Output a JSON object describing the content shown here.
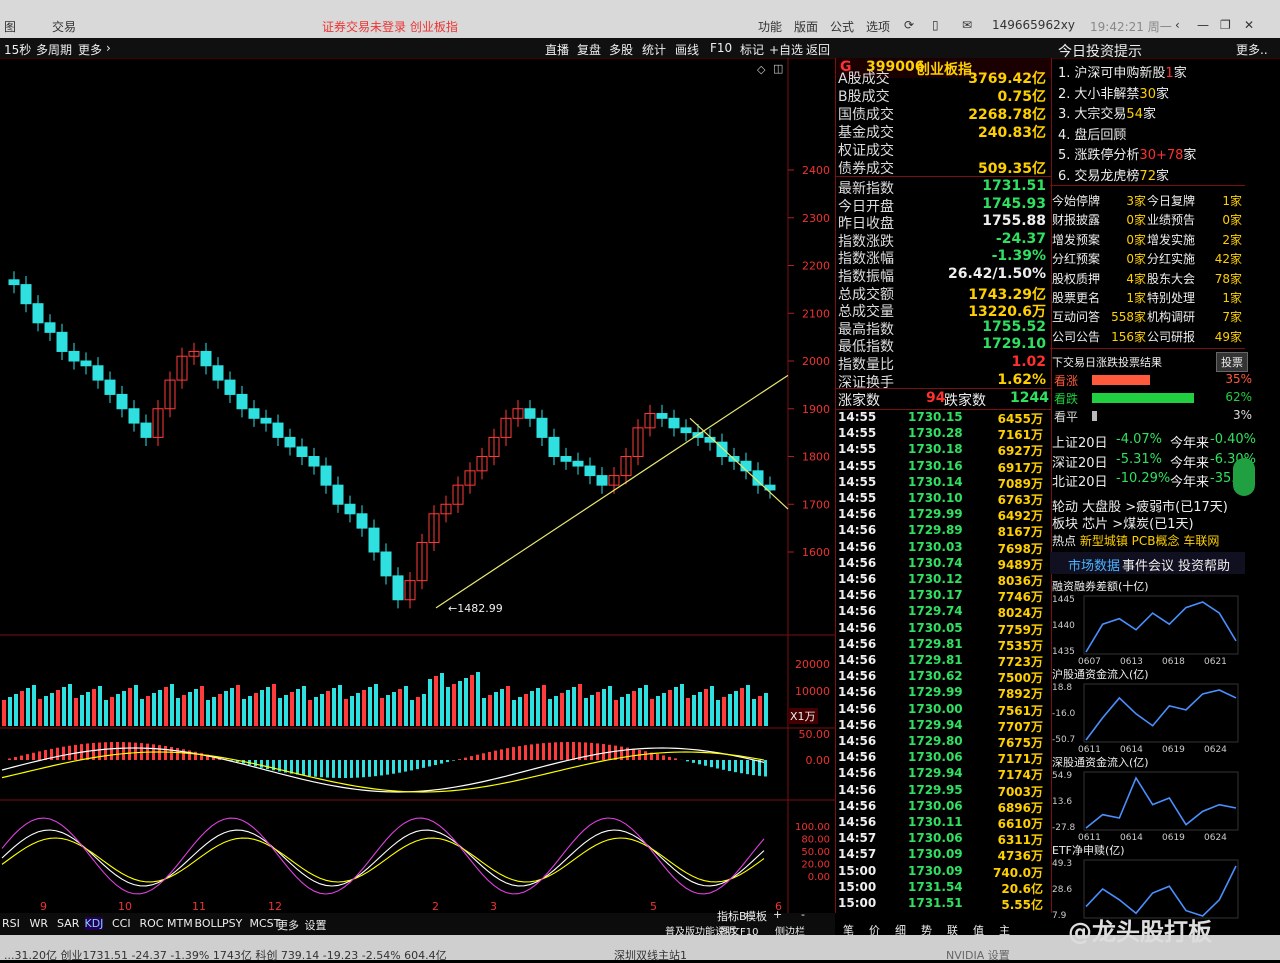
{
  "titlebar": {
    "menu_left": "图",
    "menu_trade": "交易",
    "login_status": "证券交易未登录  创业板指",
    "menus": [
      "功能",
      "版面",
      "公式",
      "选项"
    ],
    "user_id": "149665962xy",
    "clock": "19:42:21 周一"
  },
  "toolbar": {
    "period": "15秒",
    "multi_period": "多周期",
    "more": "更多",
    "buttons": [
      "直播",
      "复盘",
      "多股",
      "统计",
      "画线",
      "F10",
      "标记",
      "+自选",
      "返回"
    ]
  },
  "chart": {
    "price_axis": [
      "2400",
      "2300",
      "2200",
      "2100",
      "2000",
      "1900",
      "1800",
      "1700",
      "1600"
    ],
    "low_label": "1482.99",
    "volume_axis": [
      "20000",
      "10000"
    ],
    "volume_unit": "X1万",
    "macd_axis": [
      "50.00",
      "0.00"
    ],
    "kdj_axis": [
      "100.00",
      "80.00",
      "50.00",
      "20.00",
      "0.00"
    ],
    "date_marks": [
      "9",
      "10",
      "11",
      "12",
      "2",
      "3",
      "5",
      "6"
    ],
    "colors": {
      "up": "#ff3b3b",
      "down": "#2fe0e0",
      "trend": "#e8e870"
    }
  },
  "quote": {
    "code": "G",
    "index_code": "399006",
    "index_name": "创业板指",
    "turnover": [
      {
        "label": "A股成交",
        "value": "3769.42亿"
      },
      {
        "label": "B股成交",
        "value": "0.75亿"
      },
      {
        "label": "国债成交",
        "value": "2268.78亿"
      },
      {
        "label": "基金成交",
        "value": "240.83亿"
      },
      {
        "label": "权证成交",
        "value": ""
      },
      {
        "label": "债券成交",
        "value": "509.35亿"
      }
    ],
    "stats": [
      {
        "label": "最新指数",
        "value": "1731.51",
        "color": "g"
      },
      {
        "label": "今日开盘",
        "value": "1745.93",
        "color": "g"
      },
      {
        "label": "昨日收盘",
        "value": "1755.88",
        "color": "w"
      },
      {
        "label": "指数涨跌",
        "value": "-24.37",
        "color": "g"
      },
      {
        "label": "指数涨幅",
        "value": "-1.39%",
        "color": "g"
      },
      {
        "label": "指数振幅",
        "value": "26.42/1.50%",
        "color": "w"
      },
      {
        "label": "总成交额",
        "value": "1743.29亿",
        "color": "y"
      },
      {
        "label": "总成交量",
        "value": "13220.6万",
        "color": "y"
      },
      {
        "label": "最高指数",
        "value": "1755.52",
        "color": "g"
      },
      {
        "label": "最低指数",
        "value": "1729.10",
        "color": "g"
      },
      {
        "label": "指数量比",
        "value": "1.02",
        "color": "r"
      },
      {
        "label": "深证换手",
        "value": "1.62%",
        "color": "y"
      }
    ],
    "updown": {
      "up_label": "涨家数",
      "up": "94",
      "down_label": "跌家数",
      "down": "1244"
    },
    "ticks": [
      {
        "t": "14:55",
        "p": "1730.15",
        "v": "6455万"
      },
      {
        "t": "14:55",
        "p": "1730.28",
        "v": "7161万"
      },
      {
        "t": "14:55",
        "p": "1730.18",
        "v": "6927万"
      },
      {
        "t": "14:55",
        "p": "1730.16",
        "v": "6917万"
      },
      {
        "t": "14:55",
        "p": "1730.14",
        "v": "7089万"
      },
      {
        "t": "14:55",
        "p": "1730.10",
        "v": "6763万"
      },
      {
        "t": "14:56",
        "p": "1729.99",
        "v": "6492万"
      },
      {
        "t": "14:56",
        "p": "1729.89",
        "v": "8167万"
      },
      {
        "t": "14:56",
        "p": "1730.03",
        "v": "7698万"
      },
      {
        "t": "14:56",
        "p": "1730.74",
        "v": "9489万"
      },
      {
        "t": "14:56",
        "p": "1730.12",
        "v": "8036万"
      },
      {
        "t": "14:56",
        "p": "1730.17",
        "v": "7746万"
      },
      {
        "t": "14:56",
        "p": "1729.74",
        "v": "8024万"
      },
      {
        "t": "14:56",
        "p": "1730.05",
        "v": "7759万"
      },
      {
        "t": "14:56",
        "p": "1729.81",
        "v": "7535万"
      },
      {
        "t": "14:56",
        "p": "1729.81",
        "v": "7723万"
      },
      {
        "t": "14:56",
        "p": "1730.62",
        "v": "7500万"
      },
      {
        "t": "14:56",
        "p": "1729.99",
        "v": "7892万"
      },
      {
        "t": "14:56",
        "p": "1730.00",
        "v": "7561万"
      },
      {
        "t": "14:56",
        "p": "1729.94",
        "v": "7707万"
      },
      {
        "t": "14:56",
        "p": "1729.80",
        "v": "7675万"
      },
      {
        "t": "14:56",
        "p": "1730.06",
        "v": "7171万"
      },
      {
        "t": "14:56",
        "p": "1729.94",
        "v": "7174万"
      },
      {
        "t": "14:56",
        "p": "1729.95",
        "v": "7003万"
      },
      {
        "t": "14:56",
        "p": "1730.06",
        "v": "6896万"
      },
      {
        "t": "14:56",
        "p": "1730.11",
        "v": "6610万"
      },
      {
        "t": "14:57",
        "p": "1730.06",
        "v": "6311万"
      },
      {
        "t": "14:57",
        "p": "1730.09",
        "v": "4736万"
      },
      {
        "t": "15:00",
        "p": "1730.09",
        "v": "740.0万"
      },
      {
        "t": "15:00",
        "p": "1731.54",
        "v": "20.6亿"
      },
      {
        "t": "15:00",
        "p": "1731.51",
        "v": "5.55亿"
      }
    ]
  },
  "right": {
    "header": "今日投资提示",
    "more": "更多..",
    "tips": [
      {
        "n": "1.",
        "text": "沪深可申购新股",
        "num": "1",
        "unit": "家",
        "c": "r"
      },
      {
        "n": "2.",
        "text": "大小非解禁",
        "num": "30",
        "unit": "家",
        "c": "y"
      },
      {
        "n": "3.",
        "text": "大宗交易",
        "num": "54",
        "unit": "家",
        "c": "y"
      },
      {
        "n": "4.",
        "text": "盘后回顾",
        "num": "",
        "unit": "",
        "c": "w"
      },
      {
        "n": "5.",
        "text": "涨跌停分析",
        "num": "30+78",
        "unit": "家",
        "c": "r"
      },
      {
        "n": "6.",
        "text": "交易龙虎榜",
        "num": "72",
        "unit": "家",
        "c": "y"
      }
    ],
    "grid": [
      [
        "今始停牌",
        "3家",
        "今日复牌",
        "1家"
      ],
      [
        "财报披露",
        "0家",
        "业绩预告",
        "0家"
      ],
      [
        "增发预案",
        "0家",
        "增发实施",
        "2家"
      ],
      [
        "分红预案",
        "0家",
        "分红实施",
        "42家"
      ],
      [
        "股权质押",
        "4家",
        "股东大会",
        "78家"
      ],
      [
        "股票更名",
        "1家",
        "特别处理",
        "1家"
      ],
      [
        "互动问答",
        "558家",
        "机构调研",
        "7家"
      ],
      [
        "公司公告",
        "156家",
        "公司研报",
        "49家"
      ]
    ],
    "vote_title": "下交易日涨跌投票结果",
    "vote_btn": "投票",
    "votes": [
      {
        "label": "看涨",
        "pct": "35%",
        "frac": 0.35,
        "color": "#ff5a3c"
      },
      {
        "label": "看跌",
        "pct": "62%",
        "frac": 0.62,
        "color": "#20d040"
      },
      {
        "label": "看平",
        "pct": "3%",
        "frac": 0.03,
        "color": "#bbbbbb"
      }
    ],
    "perf": [
      [
        "上证20日",
        "-4.07%",
        "今年来",
        "-0.40%"
      ],
      [
        "深证20日",
        "-5.31%",
        "今年来",
        "-6.30%"
      ],
      [
        "北证20日",
        "-10.29%",
        "今年来",
        "-35.0"
      ]
    ],
    "rotation": [
      "轮动 大盘股 >疲弱市(已17天)",
      "板块 芯片 >煤炭(已1天)"
    ],
    "hot_label": "热点",
    "hot": "新型城镇 PCB概念 车联网",
    "links": [
      "市场数据",
      "事件会议",
      "投资帮助"
    ],
    "minicharts": [
      {
        "title": "融资融券差额(十亿)",
        "yticks": [
          "1445",
          "1440",
          "1435"
        ],
        "xticks": [
          "0607",
          "0613",
          "0618",
          "0621"
        ],
        "values": [
          1436,
          1441,
          1442,
          1440,
          1443,
          1441,
          1444,
          1445,
          1443,
          1438
        ]
      },
      {
        "title": "沪股通资金流入(亿)",
        "yticks": [
          "18.8",
          "-16.0",
          "-50.7"
        ],
        "xticks": [
          "0611",
          "0614",
          "0619",
          "0624"
        ],
        "values": [
          -48,
          -20,
          5,
          -15,
          -30,
          -5,
          -10,
          10,
          15,
          5
        ]
      },
      {
        "title": "深股通资金流入(亿)",
        "yticks": [
          "54.9",
          "13.6",
          "-27.8"
        ],
        "xticks": [
          "0611",
          "0614",
          "0619",
          "0624"
        ],
        "values": [
          -25,
          -5,
          -10,
          50,
          10,
          20,
          -20,
          0,
          10,
          5
        ]
      },
      {
        "title": "ETF净申赎(亿)",
        "yticks": [
          "49.3",
          "28.6",
          "7.9"
        ],
        "xticks": [],
        "values": [
          15,
          28,
          20,
          10,
          25,
          30,
          12,
          8,
          20,
          45
        ]
      }
    ]
  },
  "tabs": {
    "indicators": [
      "RSI",
      "WR",
      "SAR",
      "KDJ",
      "CCI",
      "ROC",
      "MTM",
      "BOLL",
      "PSY",
      "MCST",
      "更多",
      "设置"
    ],
    "right_tabs": [
      "指标B",
      "模板",
      "+",
      "-"
    ],
    "bottom": [
      "普及版功能说明",
      "图文F10",
      "侧边栏"
    ],
    "quote_tabs": [
      "笔",
      "价",
      "细",
      "势",
      "联",
      "值",
      "主"
    ]
  },
  "status": {
    "left": "...31.20亿  创业1731.51  -24.37  -1.39%  1743亿  科创  739.14  -19.23  -2.54%  604.4亿",
    "server": "深圳双线主站1",
    "watermark": "@龙头股打板",
    "nvidia": "NVIDIA 设置"
  }
}
